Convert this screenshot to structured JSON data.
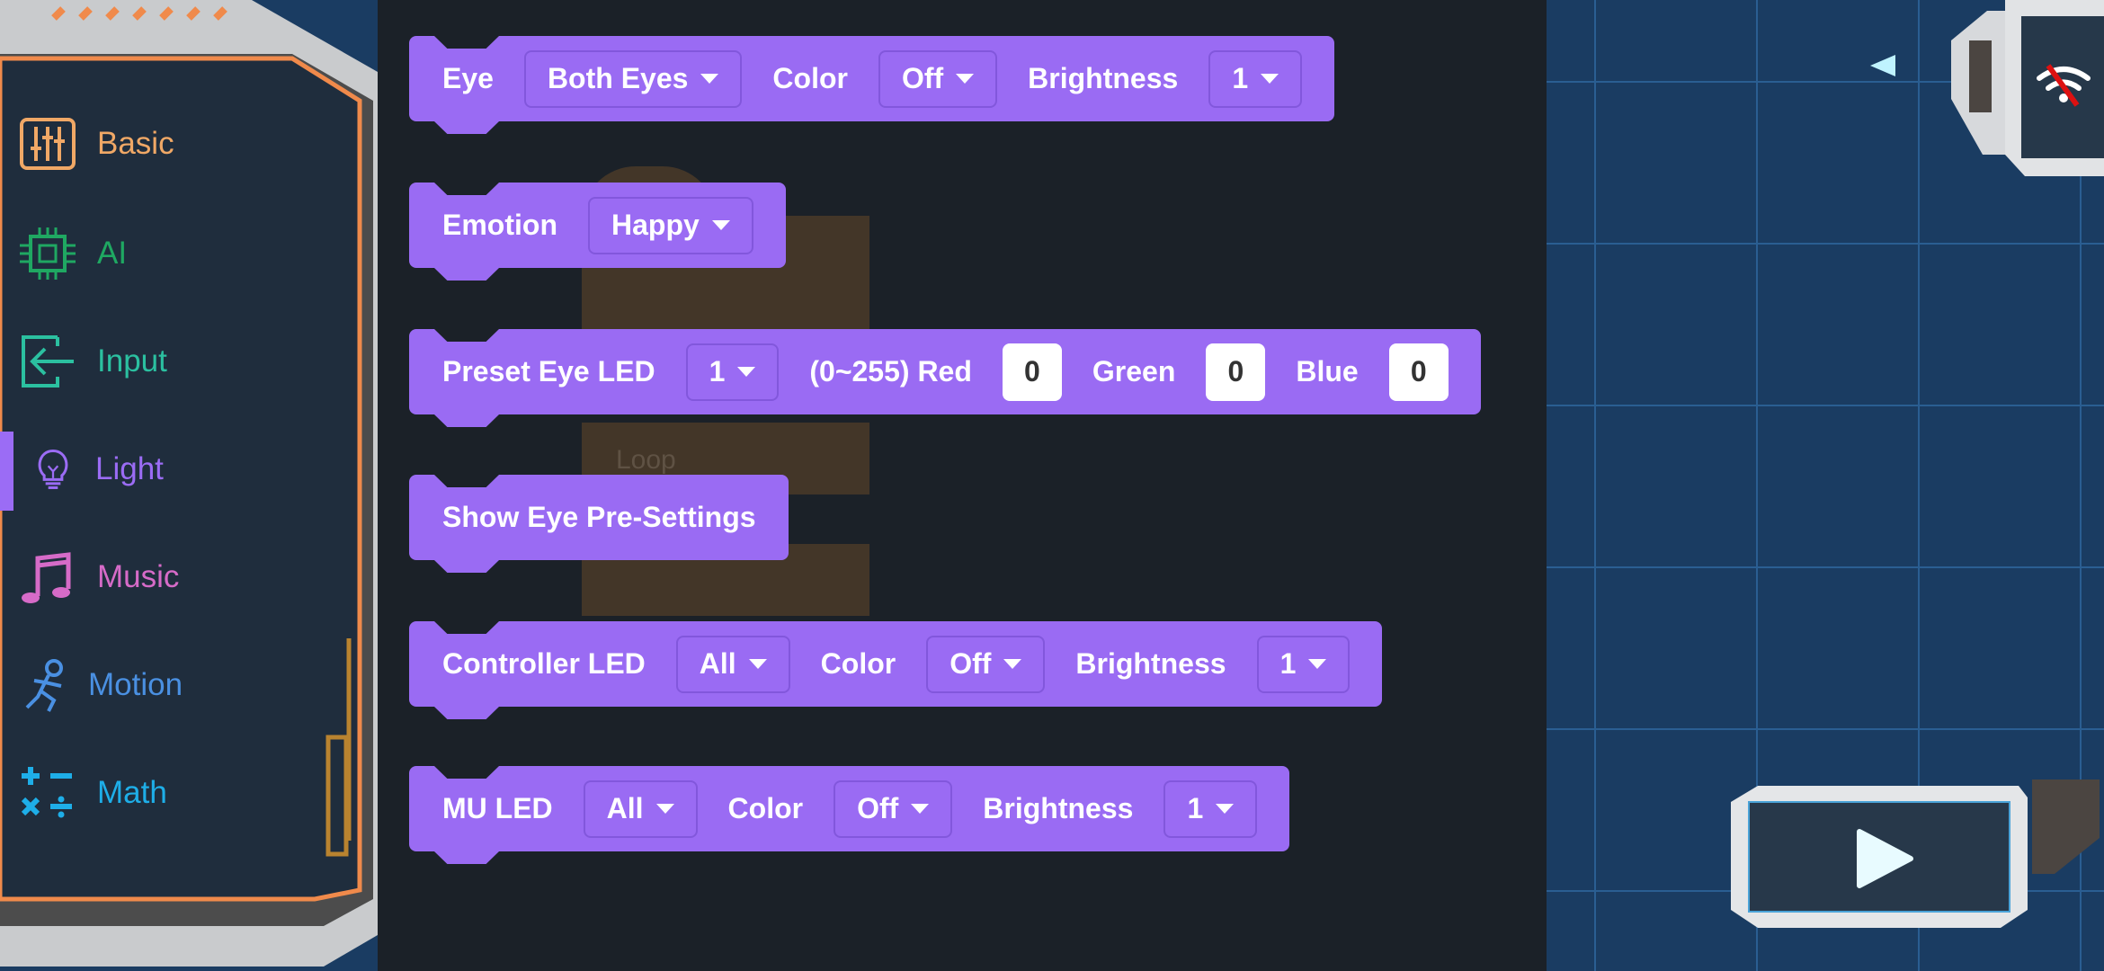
{
  "sidebar": {
    "items": [
      {
        "label": "Basic",
        "icon": "sliders-icon",
        "color": "#f0a866"
      },
      {
        "label": "AI",
        "icon": "chip-icon",
        "color": "#1fa862"
      },
      {
        "label": "Input",
        "icon": "input-arrow-icon",
        "color": "#2bc0a0"
      },
      {
        "label": "Light",
        "icon": "lightbulb-icon",
        "color": "#9b6cf5",
        "active": true
      },
      {
        "label": "Music",
        "icon": "music-note-icon",
        "color": "#d66bc8"
      },
      {
        "label": "Motion",
        "icon": "running-person-icon",
        "color": "#4a90e2"
      },
      {
        "label": "Math",
        "icon": "math-operators-icon",
        "color": "#1eaee8"
      }
    ]
  },
  "workspace": {
    "ghost_label": "Loop"
  },
  "blocks": {
    "eye": {
      "label": "Eye",
      "target": "Both Eyes",
      "color_label": "Color",
      "color": "Off",
      "brightness_label": "Brightness",
      "brightness": "1"
    },
    "emotion": {
      "label": "Emotion",
      "value": "Happy"
    },
    "preset": {
      "label": "Preset Eye LED",
      "index": "1",
      "range_label": "(0~255) Red",
      "red": "0",
      "green_label": "Green",
      "green": "0",
      "blue_label": "Blue",
      "blue": "0"
    },
    "show": {
      "label": "Show Eye Pre-Settings"
    },
    "controller": {
      "label": "Controller LED",
      "target": "All",
      "color_label": "Color",
      "color": "Off",
      "brightness_label": "Brightness",
      "brightness": "1"
    },
    "mu": {
      "label": "MU LED",
      "target": "All",
      "color_label": "Color",
      "color": "Off",
      "brightness_label": "Brightness",
      "brightness": "1"
    }
  },
  "colors": {
    "block": "#9a6bf3",
    "flyout": "#1b2128",
    "canvas": "#1a3c62"
  },
  "controls": {
    "connection_icon": "wifi-off-icon",
    "run_icon": "play-icon"
  }
}
